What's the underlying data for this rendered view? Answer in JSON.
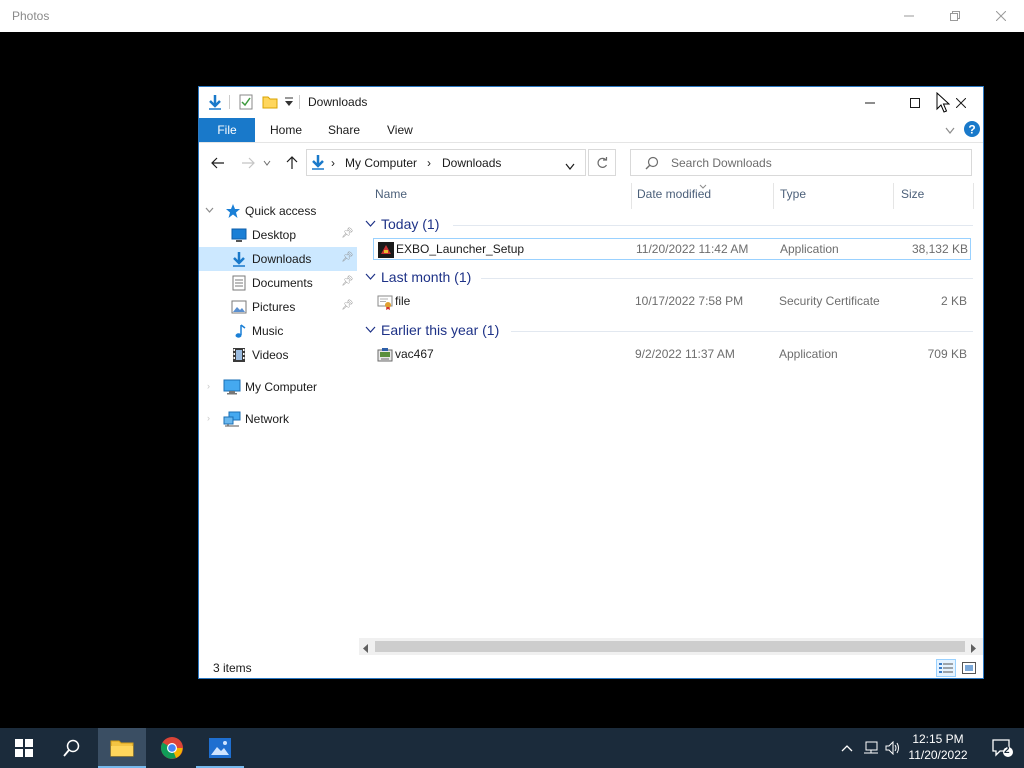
{
  "photos": {
    "title": "Photos"
  },
  "explorer": {
    "title": "Downloads",
    "ribbon": {
      "file_label": "File",
      "tabs": [
        "Home",
        "Share",
        "View"
      ]
    },
    "address": {
      "crumbs": [
        "My Computer",
        "Downloads"
      ]
    },
    "search": {
      "placeholder": "Search Downloads"
    },
    "nav": {
      "quick_access": "Quick access",
      "items": [
        {
          "label": "Desktop",
          "icon": "desktop-icon",
          "pinned": true
        },
        {
          "label": "Downloads",
          "icon": "downloads-icon",
          "pinned": true,
          "selected": true
        },
        {
          "label": "Documents",
          "icon": "documents-icon",
          "pinned": true
        },
        {
          "label": "Pictures",
          "icon": "pictures-icon",
          "pinned": true
        },
        {
          "label": "Music",
          "icon": "music-icon",
          "pinned": false
        },
        {
          "label": "Videos",
          "icon": "videos-icon",
          "pinned": false
        }
      ],
      "my_computer": "My Computer",
      "network": "Network"
    },
    "columns": [
      "Name",
      "Date modified",
      "Type",
      "Size"
    ],
    "groups": [
      {
        "title": "Today (1)",
        "files": [
          {
            "name": "EXBO_Launcher_Setup",
            "date": "11/20/2022 11:42 AM",
            "type": "Application",
            "size": "38,132 KB",
            "icon": "app-icon"
          }
        ]
      },
      {
        "title": "Last month (1)",
        "files": [
          {
            "name": "file",
            "date": "10/17/2022 7:58 PM",
            "type": "Security Certificate",
            "size": "2 KB",
            "icon": "certificate-icon"
          }
        ]
      },
      {
        "title": "Earlier this year (1)",
        "files": [
          {
            "name": "vac467",
            "date": "9/2/2022 11:37 AM",
            "type": "Application",
            "size": "709 KB",
            "icon": "installer-icon"
          }
        ]
      }
    ],
    "status": "3 items"
  },
  "taskbar": {
    "time": "12:15 PM",
    "date": "11/20/2022",
    "notifications": "2"
  },
  "colors": {
    "accent": "#1979ca",
    "selected": "#cce8ff",
    "group_header": "#1e3287",
    "taskbar": "#1b2b3b"
  }
}
